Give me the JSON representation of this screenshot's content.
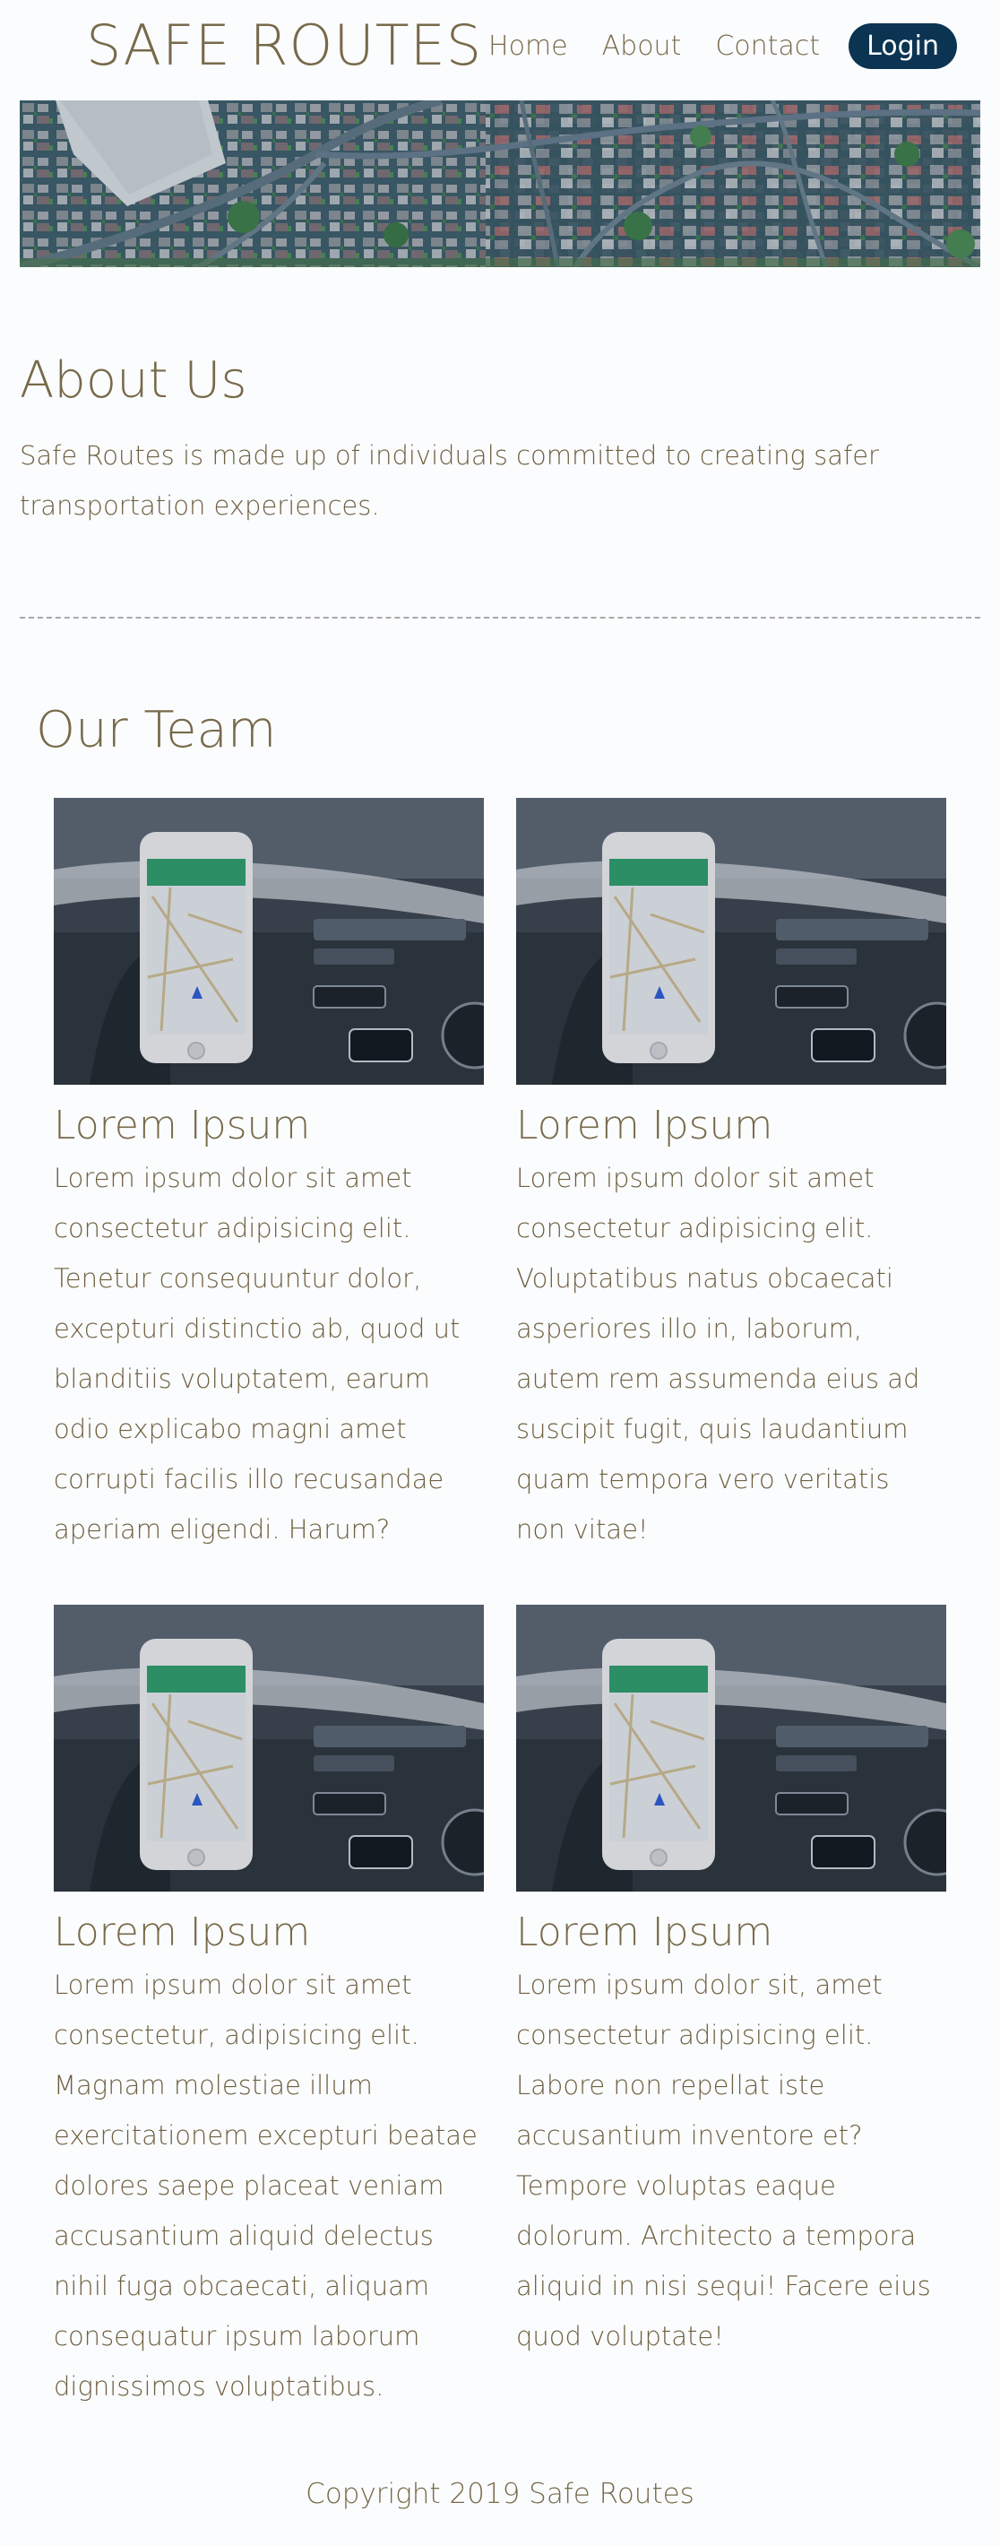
{
  "header": {
    "brand": "SAFE ROUTES",
    "nav": {
      "home": "Home",
      "about": "About",
      "contact": "Contact",
      "login": "Login"
    }
  },
  "colors": {
    "background": "#fbfcfe",
    "text": "#776a4a",
    "login_button": "#0b3452"
  },
  "about": {
    "title": "About Us",
    "text": "Safe Routes is made up of individuals committed to creating safer transportation experiences."
  },
  "team": {
    "title": "Our Team",
    "members": [
      {
        "name": "Lorem Ipsum",
        "text": "Lorem ipsum dolor sit amet consectetur adipisicing elit. Tenetur consequuntur dolor, excepturi distinctio ab, quod ut blanditiis voluptatem, earum odio explicabo magni amet corrupti facilis illo recusandae aperiam eligendi. Harum?"
      },
      {
        "name": "Lorem Ipsum",
        "text": "Lorem ipsum dolor sit amet consectetur adipisicing elit. Voluptatibus natus obcaecati asperiores illo in, laborum, autem rem assumenda eius ad suscipit fugit, quis laudantium quam tempora vero veritatis non vitae!"
      },
      {
        "name": "Lorem Ipsum",
        "text": "Lorem ipsum dolor sit amet consectetur, adipisicing elit. Magnam molestiae illum exercitationem excepturi beatae dolores saepe placeat veniam accusantium aliquid delectus nihil fuga obcaecati, aliquam consequatur ipsum laborum dignissimos voluptatibus."
      },
      {
        "name": "Lorem Ipsum",
        "text": "Lorem ipsum dolor sit, amet consectetur adipisicing elit. Labore non repellat iste accusantium inventore et? Tempore voluptas eaque dolorum. Architecto a tempora aliquid in nisi sequi! Facere eius quod voluptate!"
      }
    ]
  },
  "footer": {
    "copyright": "Copyright 2019 Safe Routes"
  }
}
